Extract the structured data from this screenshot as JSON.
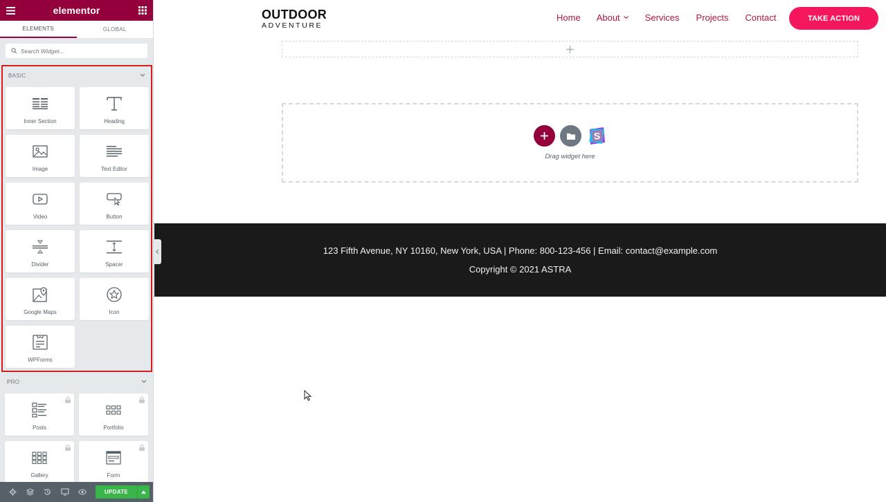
{
  "editor": {
    "brand": "elementor",
    "tabs": [
      {
        "label": "ELEMENTS",
        "active": true
      },
      {
        "label": "GLOBAL",
        "active": false
      }
    ],
    "search_placeholder": "Search Widget...",
    "categories": {
      "basic": {
        "title": "BASIC",
        "widgets": [
          {
            "label": "Inner Section",
            "icon": "inner-section-icon"
          },
          {
            "label": "Heading",
            "icon": "heading-icon"
          },
          {
            "label": "Image",
            "icon": "image-icon"
          },
          {
            "label": "Text Editor",
            "icon": "text-editor-icon"
          },
          {
            "label": "Video",
            "icon": "video-icon"
          },
          {
            "label": "Button",
            "icon": "button-icon"
          },
          {
            "label": "Divider",
            "icon": "divider-icon"
          },
          {
            "label": "Spacer",
            "icon": "spacer-icon"
          },
          {
            "label": "Google Maps",
            "icon": "google-maps-icon"
          },
          {
            "label": "Icon",
            "icon": "star-icon"
          },
          {
            "label": "WPForms",
            "icon": "wpforms-icon"
          }
        ]
      },
      "pro": {
        "title": "PRO",
        "widgets": [
          {
            "label": "Posts",
            "icon": "posts-icon",
            "locked": true
          },
          {
            "label": "Portfolio",
            "icon": "portfolio-icon",
            "locked": true
          },
          {
            "label": "Gallery",
            "icon": "gallery-icon",
            "locked": true
          },
          {
            "label": "Form",
            "icon": "form-icon",
            "locked": true
          }
        ]
      }
    },
    "footer": {
      "update_label": "UPDATE"
    },
    "colors": {
      "brand": "#93003c",
      "highlight": "#d41c1c",
      "update": "#39b54a"
    }
  },
  "site": {
    "logo_top": "OUTDOOR",
    "logo_bottom": "ADVENTURE",
    "nav": [
      "Home",
      "About",
      "Services",
      "Projects",
      "Contact"
    ],
    "cta": "TAKE ACTION",
    "drop_text": "Drag widget here",
    "footer_address": "123 Fifth Avenue, NY 10160, New York, USA | Phone: 800-123-456 | Email: contact@example.com",
    "footer_copyright": "Copyright © 2021 ASTRA",
    "colors": {
      "nav": "#b0163f",
      "cta": "#f5175d",
      "footer_bg": "#1a1a1a"
    }
  }
}
